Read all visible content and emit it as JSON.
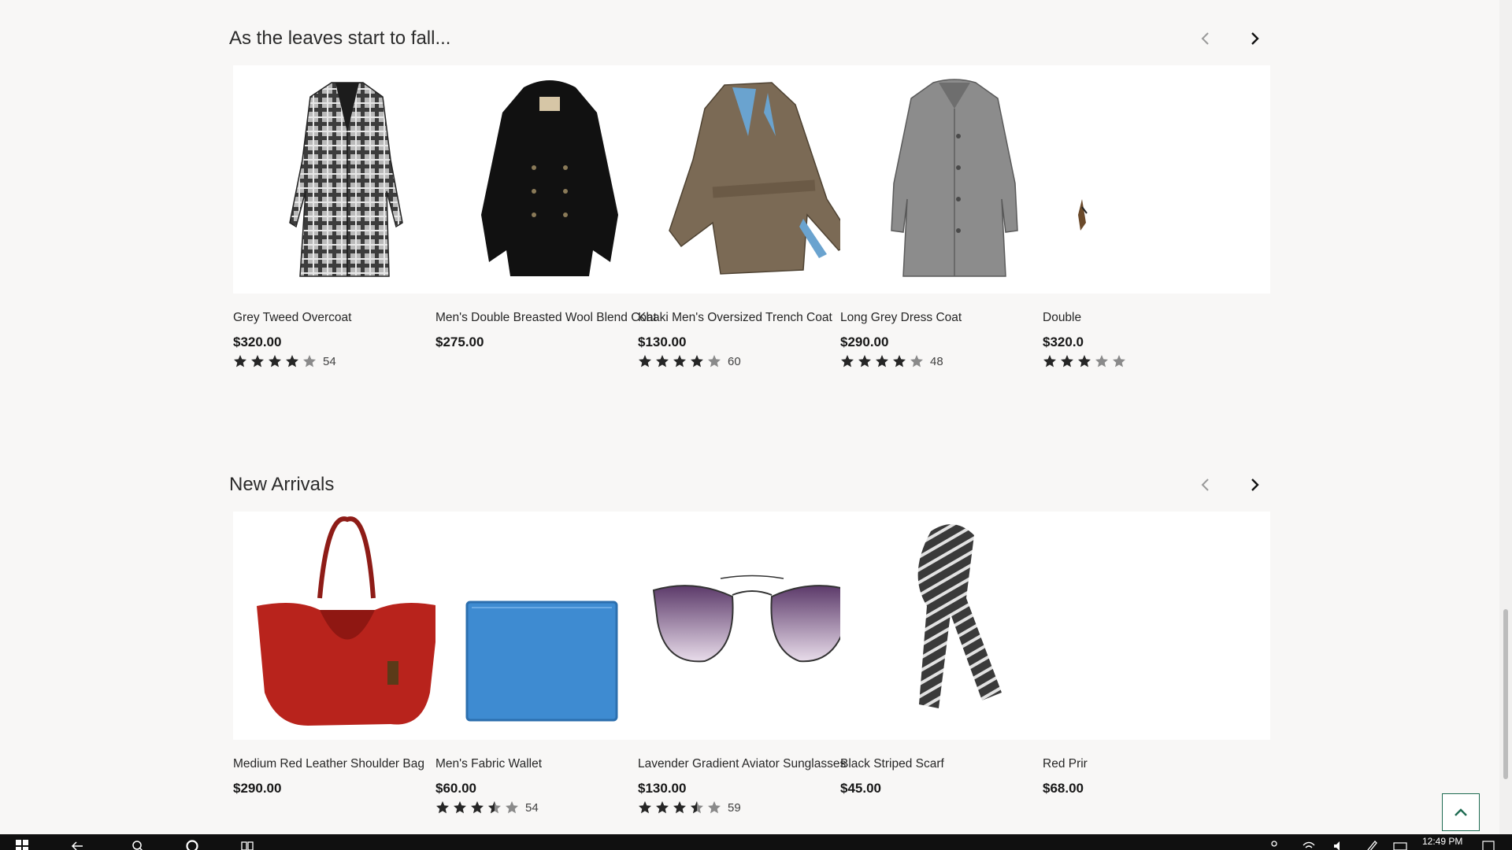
{
  "sections": [
    {
      "title": "As the leaves start to fall...",
      "products": [
        {
          "name": "Grey Tweed Overcoat",
          "price": "$320.00",
          "rating": 4,
          "reviews": "54",
          "image": "grey-plaid-coat"
        },
        {
          "name": "Men's Double Breasted Wool Blend Coat",
          "price": "$275.00",
          "rating": null,
          "reviews": "",
          "image": "black-peacoat"
        },
        {
          "name": "Khaki Men's Oversized Trench Coat",
          "price": "$130.00",
          "rating": 4,
          "reviews": "60",
          "image": "khaki-trench"
        },
        {
          "name": "Long Grey Dress Coat",
          "price": "$290.00",
          "rating": 4,
          "reviews": "48",
          "image": "grey-dress-coat"
        },
        {
          "name": "Double",
          "price": "$320.0",
          "rating": 3,
          "reviews": "",
          "image": "partial-coat"
        }
      ]
    },
    {
      "title": "New Arrivals",
      "products": [
        {
          "name": "Medium Red Leather Shoulder Bag",
          "price": "$290.00",
          "rating": null,
          "reviews": "",
          "image": "red-bag"
        },
        {
          "name": "Men's Fabric Wallet",
          "price": "$60.00",
          "rating": 3.5,
          "reviews": "54",
          "image": "blue-wallet"
        },
        {
          "name": "Lavender Gradient Aviator Sunglasses",
          "price": "$130.00",
          "rating": 3.5,
          "reviews": "59",
          "image": "aviator-sunglasses"
        },
        {
          "name": "Black Striped Scarf",
          "price": "$45.00",
          "rating": null,
          "reviews": "",
          "image": "striped-scarf"
        },
        {
          "name": "Red Prir",
          "price": "$68.00",
          "rating": null,
          "reviews": "",
          "image": "partial-blank"
        }
      ]
    }
  ],
  "taskbar": {
    "clock": "12:49 PM"
  },
  "colors": {
    "background": "#f8f7f6",
    "star_filled": "#262626",
    "star_empty": "#8a8a8a",
    "accent_border": "#1e6b52",
    "taskbar": "#101010"
  },
  "icons": {
    "prev": "chevron-left-icon",
    "next": "chevron-right-icon",
    "back_to_top": "chevron-up-icon",
    "star": "star-icon"
  }
}
